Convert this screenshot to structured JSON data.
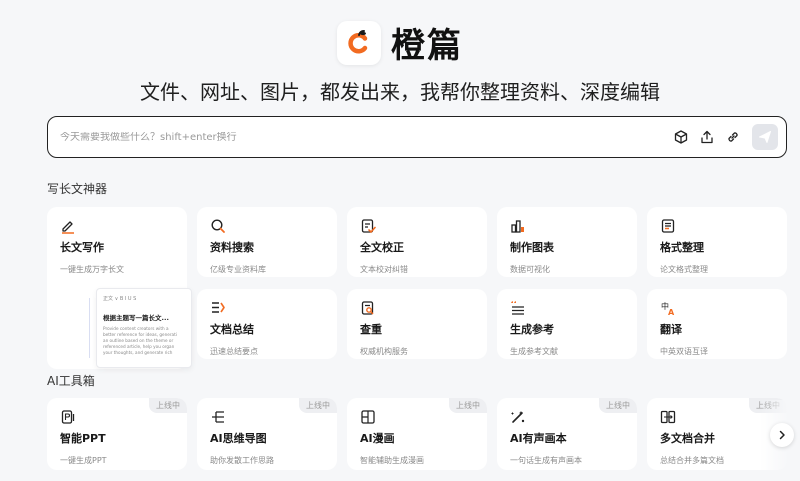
{
  "brand": {
    "name": "橙篇"
  },
  "slogan": "文件、网址、图片，都发出来，我帮你整理资料、深度编辑",
  "search": {
    "placeholder": "今天需要我做些什么？shift+enter换行"
  },
  "section1": {
    "title": "写长文神器",
    "cards": [
      {
        "title": "长文写作",
        "desc": "一键生成万字长文",
        "icon": "pen-icon"
      },
      {
        "title": "资料搜索",
        "desc": "亿级专业资料库",
        "icon": "search-icon"
      },
      {
        "title": "全文校正",
        "desc": "文本校对纠错",
        "icon": "proofread-icon"
      },
      {
        "title": "制作图表",
        "desc": "数据可视化",
        "icon": "chart-icon"
      },
      {
        "title": "格式整理",
        "desc": "论文格式整理",
        "icon": "format-icon"
      },
      {
        "title": "文档总结",
        "desc": "迅速总结要点",
        "icon": "summary-icon"
      },
      {
        "title": "查重",
        "desc": "权威机构服务",
        "icon": "plagiarism-check-icon"
      },
      {
        "title": "生成参考",
        "desc": "生成参考文献",
        "icon": "reference-icon"
      },
      {
        "title": "翻译",
        "desc": "中英双语互译",
        "icon": "translate-icon"
      }
    ],
    "preview": {
      "toolbar": "正文 ∨  B  I  U  S",
      "title": "根据主题写一篇长文...",
      "lines": [
        "Provide content creators with a",
        "better reference for ideas, generati",
        "an outline based on the theme or",
        "referenced article, help you organ",
        "your thoughts, and generate rich"
      ]
    }
  },
  "section2": {
    "title": "AI工具箱",
    "badge": "上线中",
    "cards": [
      {
        "title": "智能PPT",
        "desc": "一键生成PPT",
        "icon": "ppt-icon"
      },
      {
        "title": "AI思维导图",
        "desc": "助你发散工作思路",
        "icon": "mindmap-icon"
      },
      {
        "title": "AI漫画",
        "desc": "智能辅助生成漫画",
        "icon": "comic-icon"
      },
      {
        "title": "AI有声画本",
        "desc": "一句话生成有声画本",
        "icon": "audio-book-icon"
      },
      {
        "title": "多文档合并",
        "desc": "总结合并多篇文档",
        "icon": "merge-docs-icon"
      }
    ]
  },
  "colors": {
    "accent": "#f26b21",
    "background": "#f6f7f9",
    "card": "#ffffff"
  }
}
